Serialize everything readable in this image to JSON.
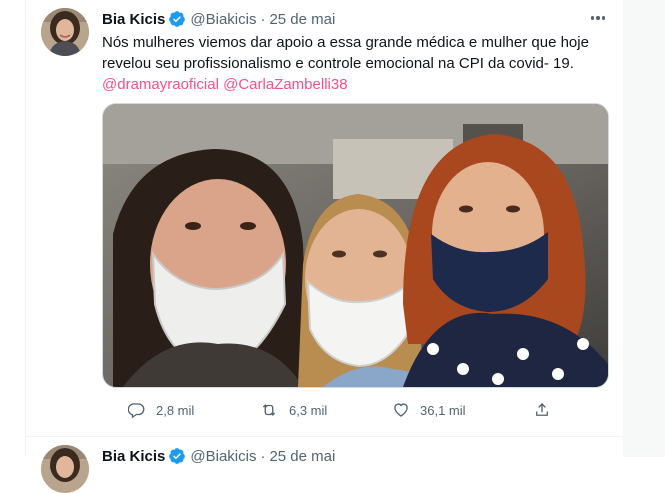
{
  "tweets": [
    {
      "author": {
        "name": "Bia Kicis",
        "handle": "@Biakicis",
        "verified": true
      },
      "separator": "·",
      "date": "25 de mai",
      "text": "Nós mulheres viemos dar apoio a essa grande médica e mulher que hoje revelou seu profissionalismo e controle emocional na CPI da covid- 19.",
      "mentions": [
        "@dramayraoficial",
        "@CarlaZambelli38"
      ],
      "stats": {
        "replies": "2,8 mil",
        "retweets": "6,3 mil",
        "likes": "36,1 mil"
      }
    },
    {
      "author": {
        "name": "Bia Kicis",
        "handle": "@Biakicis",
        "verified": true
      },
      "separator": "·",
      "date": "25 de mai"
    }
  ],
  "colors": {
    "accent": "#1d9bf0",
    "mention": "#f4518b",
    "text": "#0f1419",
    "muted": "#536471"
  },
  "icons": [
    "verified-badge-icon",
    "more-icon",
    "reply-icon",
    "retweet-icon",
    "like-icon",
    "share-icon"
  ]
}
